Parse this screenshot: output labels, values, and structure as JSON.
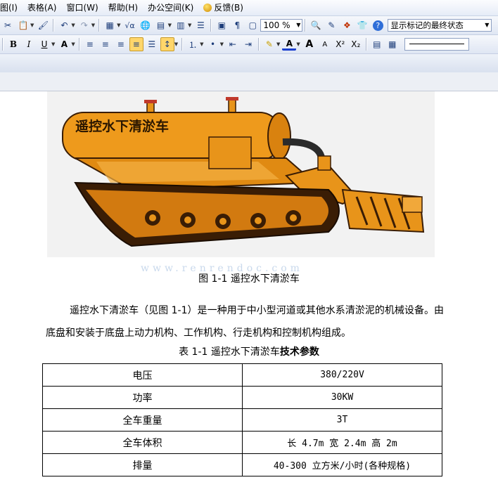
{
  "menu": {
    "items": [
      "图(I)",
      "表格(A)",
      "窗口(W)",
      "帮助(H)",
      "办公空间(K)",
      "反馈(B)"
    ]
  },
  "toolbar": {
    "zoom": "100 %",
    "markup_state": "显示标记的最终状态"
  },
  "format_toolbar": {
    "bold": "B",
    "italic": "I",
    "underline": "U",
    "grow_font": "A",
    "shrink_font": "A",
    "superscript": "X²",
    "subscript": "X₂"
  },
  "document": {
    "photo_label": "遥控水下清淤车",
    "watermark": "www.renrendoc.com",
    "figure_caption": "图 1-1  遥控水下清淤车",
    "paragraph": "遥控水下清淤车（见图 1-1）是一种用于中小型河道或其他水系清淤泥的机械设备。由底盘和安装于底盘上动力机构、工作机构、行走机构和控制机构组成。",
    "table_caption_plain": "表 1-1  遥控水下清淤车",
    "table_caption_bold": "技术参数",
    "table": [
      {
        "name": "电压",
        "value": "380/220V"
      },
      {
        "name": "功率",
        "value": "30KW"
      },
      {
        "name": "全车重量",
        "value": "3T"
      },
      {
        "name": "全车体积",
        "value": "长 4.7m 宽 2.4m 高 2m"
      },
      {
        "name": "排量",
        "value": "40-300 立方米/小时(各种规格)"
      }
    ]
  },
  "colors": {
    "machine_orange": "#e8941a",
    "machine_dark": "#3a1d05",
    "label_text": "#2a1600"
  }
}
